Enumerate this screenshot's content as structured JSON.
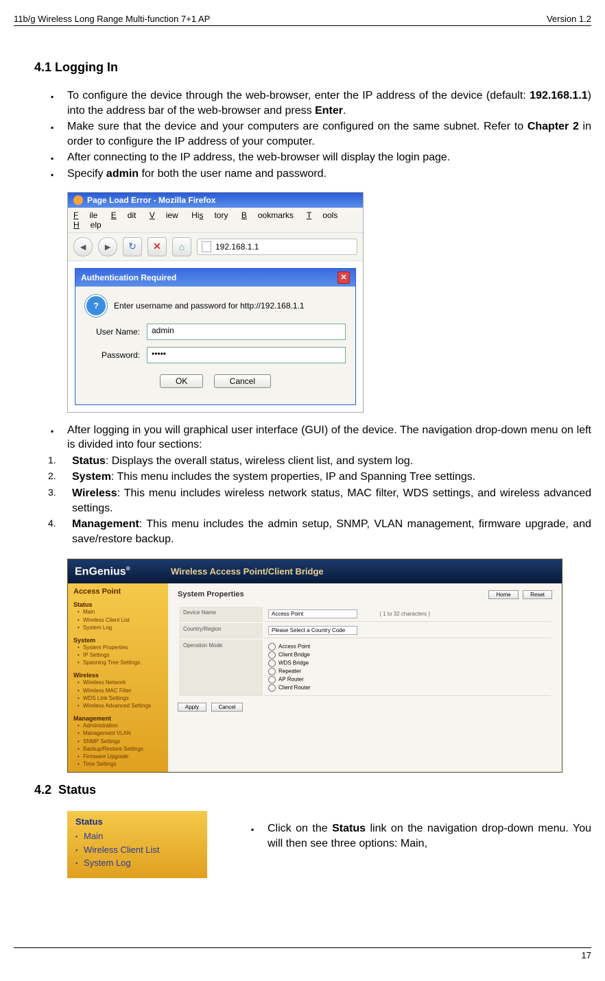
{
  "header": {
    "left": "11b/g Wireless Long Range Multi-function 7+1 AP",
    "right": "Version 1.2"
  },
  "page_number": "17",
  "section_41": {
    "number": "4.1",
    "title": "Logging In",
    "bullets_top": [
      {
        "pre": "To configure the device through the web-browser, enter the IP address of the device (default: ",
        "b1": "192.168.1.1",
        "mid": ") into the address bar of the web-browser and press ",
        "b2": "Enter",
        "post": "."
      },
      {
        "pre": "Make sure that the device and your computers are configured on the same subnet. Refer to ",
        "b1": "Chapter 2",
        "post": " in order to configure the IP address of your computer."
      },
      {
        "text": "After connecting to the IP address, the web-browser will display the login page."
      },
      {
        "pre": "Specify ",
        "b1": "admin",
        "post": " for both the user name and password."
      }
    ],
    "bullets_mid": [
      {
        "text": "After logging in you will graphical user interface (GUI) of the device. The navigation drop-down menu on left is divided into four sections:"
      }
    ],
    "numbered": [
      {
        "n": "1.",
        "b": "Status",
        "text": ": Displays the overall status, wireless client list, and system log."
      },
      {
        "n": "2.",
        "b": "System",
        "text": ": This menu includes the system properties, IP and Spanning Tree settings."
      },
      {
        "n": "3.",
        "b": "Wireless",
        "text": ": This menu includes wireless network status, MAC filter, WDS settings, and wireless advanced settings."
      },
      {
        "n": "4.",
        "b": "Management",
        "text": ": This menu includes the admin setup, SNMP, VLAN management, firmware upgrade, and save/restore backup."
      }
    ]
  },
  "firefox": {
    "title": "Page Load Error - Mozilla Firefox",
    "menu": [
      "File",
      "Edit",
      "View",
      "History",
      "Bookmarks",
      "Tools",
      "Help"
    ],
    "url": "192.168.1.1",
    "auth_title": "Authentication Required",
    "auth_msg": "Enter username and password for http://192.168.1.1",
    "user_label": "User Name:",
    "user_value": "admin",
    "pass_label": "Password:",
    "pass_value": "•••••",
    "ok": "OK",
    "cancel": "Cancel"
  },
  "engenius": {
    "logo": "EnGenius",
    "banner": "Wireless Access Point/Client Bridge",
    "side_title": "Access Point",
    "sections": {
      "status": {
        "title": "Status",
        "items": [
          "Main",
          "Wireless Client List",
          "System Log"
        ]
      },
      "system": {
        "title": "System",
        "items": [
          "System Properties",
          "IP Settings",
          "Spanning Tree Settings"
        ]
      },
      "wireless": {
        "title": "Wireless",
        "items": [
          "Wireless Network",
          "Wireless MAC Filter",
          "WDS Link Settings",
          "Wireless Advanced Settings"
        ]
      },
      "management": {
        "title": "Management",
        "items": [
          "Administration",
          "Management VLAN",
          "SNMP Settings",
          "Backup/Restore Settings",
          "Firmware Upgrade",
          "Time Settings"
        ]
      }
    },
    "main": {
      "title": "System Properties",
      "home": "Home",
      "reset": "Reset",
      "device_name_lbl": "Device Name",
      "device_name_val": "Access Point",
      "device_name_hint": "( 1 to 32 characters )",
      "country_lbl": "Country/Region",
      "country_val": "Please Select a Country Code",
      "opmode_lbl": "Operation Mode",
      "opmodes": [
        "Access Point",
        "Client Bridge",
        "WDS Bridge",
        "Repeater",
        "AP Router",
        "Client Router"
      ],
      "apply": "Apply",
      "cancel": "Cancel"
    }
  },
  "section_42": {
    "number": "4.2",
    "title": "Status",
    "bullet": {
      "pre": "Click on the ",
      "b": "Status",
      "post": " link on the navigation drop-down menu. You will then see three options: Main,"
    },
    "menu": {
      "title": "Status",
      "items": [
        "Main",
        "Wireless Client List",
        "System Log"
      ]
    }
  }
}
